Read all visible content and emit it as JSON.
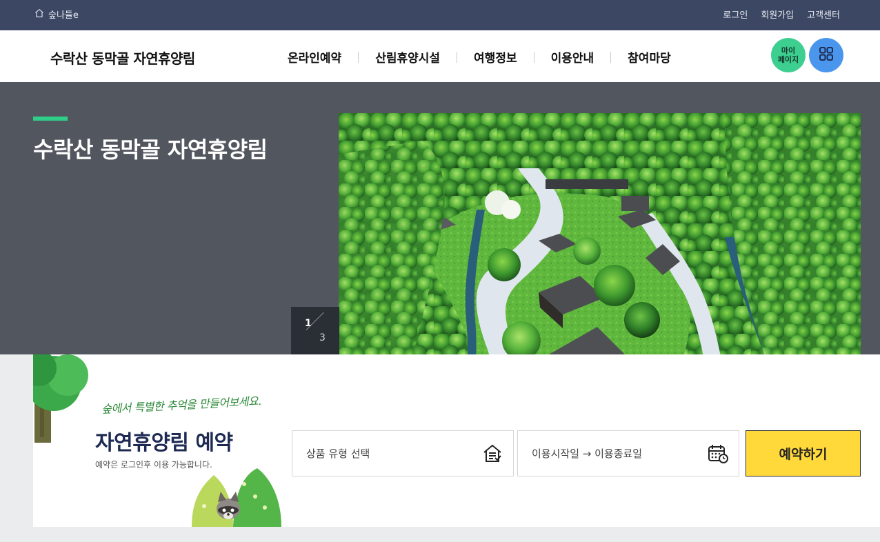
{
  "topbar": {
    "home_label": "숲나들e",
    "links": [
      "로그인",
      "회원가입",
      "고객센터"
    ]
  },
  "header": {
    "site_title": "수락산 동막골 자연휴양림",
    "nav": [
      "온라인예약",
      "산림휴양시설",
      "여행정보",
      "이용안내",
      "참여마당"
    ],
    "mypage_label_1": "마이",
    "mypage_label_2": "페이지"
  },
  "hero": {
    "title": "수락산 동막골 자연휴양림",
    "slide_current": "1",
    "slide_total": "3"
  },
  "reservation": {
    "handwritten_tagline": "숲에서 특별한 추억을 만들어보세요.",
    "title": "자연휴양림 예약",
    "note": "예약은 로그인후 이용 가능합니다.",
    "product_type_label": "상품 유형 선택",
    "date_range_label": "이용시작일 → 이용종료일",
    "reserve_button": "예약하기"
  },
  "colors": {
    "topbar_bg": "#3c4763",
    "hero_bg": "#52565f",
    "accent_green": "#2fcf8a",
    "mypage_green": "#3dcf8f",
    "menu_blue": "#4a96ec",
    "reserve_yellow": "#ffd83a",
    "title_navy": "#1e2a52"
  },
  "icons": {
    "home": "home-icon",
    "menu": "grid-menu-icon",
    "prev": "arrow-left-icon",
    "next": "arrow-right-icon",
    "product_type": "house-list-icon",
    "calendar": "calendar-clock-icon"
  }
}
